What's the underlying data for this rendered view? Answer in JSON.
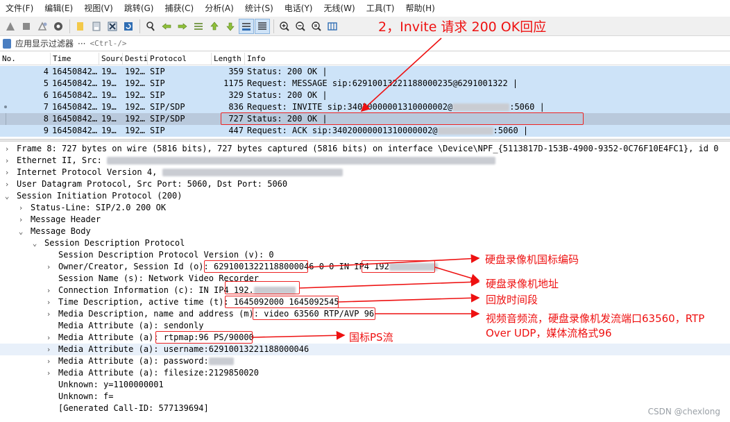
{
  "menu": [
    "文件(F)",
    "编辑(E)",
    "视图(V)",
    "跳转(G)",
    "捕获(C)",
    "分析(A)",
    "统计(S)",
    "电话(Y)",
    "无线(W)",
    "工具(T)",
    "帮助(H)"
  ],
  "filter": {
    "label": "应用显示过滤器",
    "ellipsis": "···",
    "placeholder": "<Ctrl-/>"
  },
  "packet_list": {
    "columns": [
      "No.",
      "Time",
      "Sourc",
      "Desti",
      "Protocol",
      "Length",
      "Info"
    ],
    "rows": [
      {
        "no": "4",
        "time": "16450842…",
        "src": "19…",
        "dst": "192…",
        "proto": "SIP",
        "len": "359",
        "info": "Status: 200 OK |"
      },
      {
        "no": "5",
        "time": "16450842…",
        "src": "19…",
        "dst": "192…",
        "proto": "SIP",
        "len": "1175",
        "info": "Request: MESSAGE sip:62910013221188000235@6291001322 |"
      },
      {
        "no": "6",
        "time": "16450842…",
        "src": "19…",
        "dst": "192…",
        "proto": "SIP",
        "len": "329",
        "info": "Status: 200 OK |"
      },
      {
        "no": "7",
        "time": "16450842…",
        "src": "19…",
        "dst": "192…",
        "proto": "SIP/SDP",
        "len": "836",
        "info_a": "Request: INVITE sip:34020000001310000002@",
        "info_b": ":5060 |"
      },
      {
        "no": "8",
        "time": "16450842…",
        "src": "19…",
        "dst": "192…",
        "proto": "SIP/SDP",
        "len": "727",
        "info": "Status: 200 OK |"
      },
      {
        "no": "9",
        "time": "16450842…",
        "src": "19…",
        "dst": "192…",
        "proto": "SIP",
        "len": "447",
        "info_a": "Request: ACK sip:34020000001310000002@",
        "info_b": ":5060 |"
      }
    ]
  },
  "details": {
    "frame": "Frame 8: 727 bytes on wire (5816 bits), 727 bytes captured (5816 bits) on interface \\Device\\NPF_{5113817D-153B-4900-9352-0C76F10E4FC1}, id 0",
    "ethernet": "Ethernet II, Src: ",
    "ip": "Internet Protocol Version 4, ",
    "udp": "User Datagram Protocol, Src Port: 5060, Dst Port: 5060",
    "sip": "Session Initiation Protocol (200)",
    "status_line": "Status-Line: SIP/2.0 200 OK",
    "msg_header": "Message Header",
    "msg_body": "Message Body",
    "sdp": "Session Description Protocol",
    "version": "Session Description Protocol Version (v): 0",
    "owner_prefix": "Owner/Creator, Session Id (o): ",
    "owner_id": "62910013221188000046",
    "owner_mid": " 0 0 IN IP4 ",
    "owner_ip": "192",
    "session_name": "Session Name (s): Network Video Recorder",
    "conn_prefix": "Connection Information (c): IN IP4 ",
    "conn_ip": "192.",
    "time_prefix": "Time Description, active time (t): ",
    "time_val": "1645092000 1645092545",
    "media_prefix": "Media Description, name and address (m): ",
    "media_val": "video 63560 RTP/AVP 96",
    "attr_sendonly": "Media Attribute (a): sendonly",
    "attr_rtpmap_prefix": "Media Attribute (a): ",
    "attr_rtpmap_val": "rtpmap:96 PS/90000",
    "attr_username": "Media Attribute (a): username:62910013221188000046",
    "attr_password": "Media Attribute (a): password:",
    "attr_filesize": "Media Attribute (a): filesize:2129850020",
    "unknown_y": "Unknown: y=1100000001",
    "unknown_f": "Unknown: f=",
    "call_id": "[Generated Call-ID: 577139694]"
  },
  "annotations": {
    "title": "2，Invite 请求 200 OK回应",
    "a1": "硬盘录像机国标编码",
    "a2": "硬盘录像机地址",
    "a3": "回放时间段",
    "a4_line1": "视频音频流，硬盘录像机发流端口63560，RTP",
    "a4_line2": "Over UDP，媒体流格式96",
    "a5": "国标PS流"
  },
  "watermark": "CSDN @chexlong",
  "colors": {
    "row_bg": "#cde3f8",
    "row_selected": "#b9c9dc",
    "annotation": "#ee1111"
  }
}
